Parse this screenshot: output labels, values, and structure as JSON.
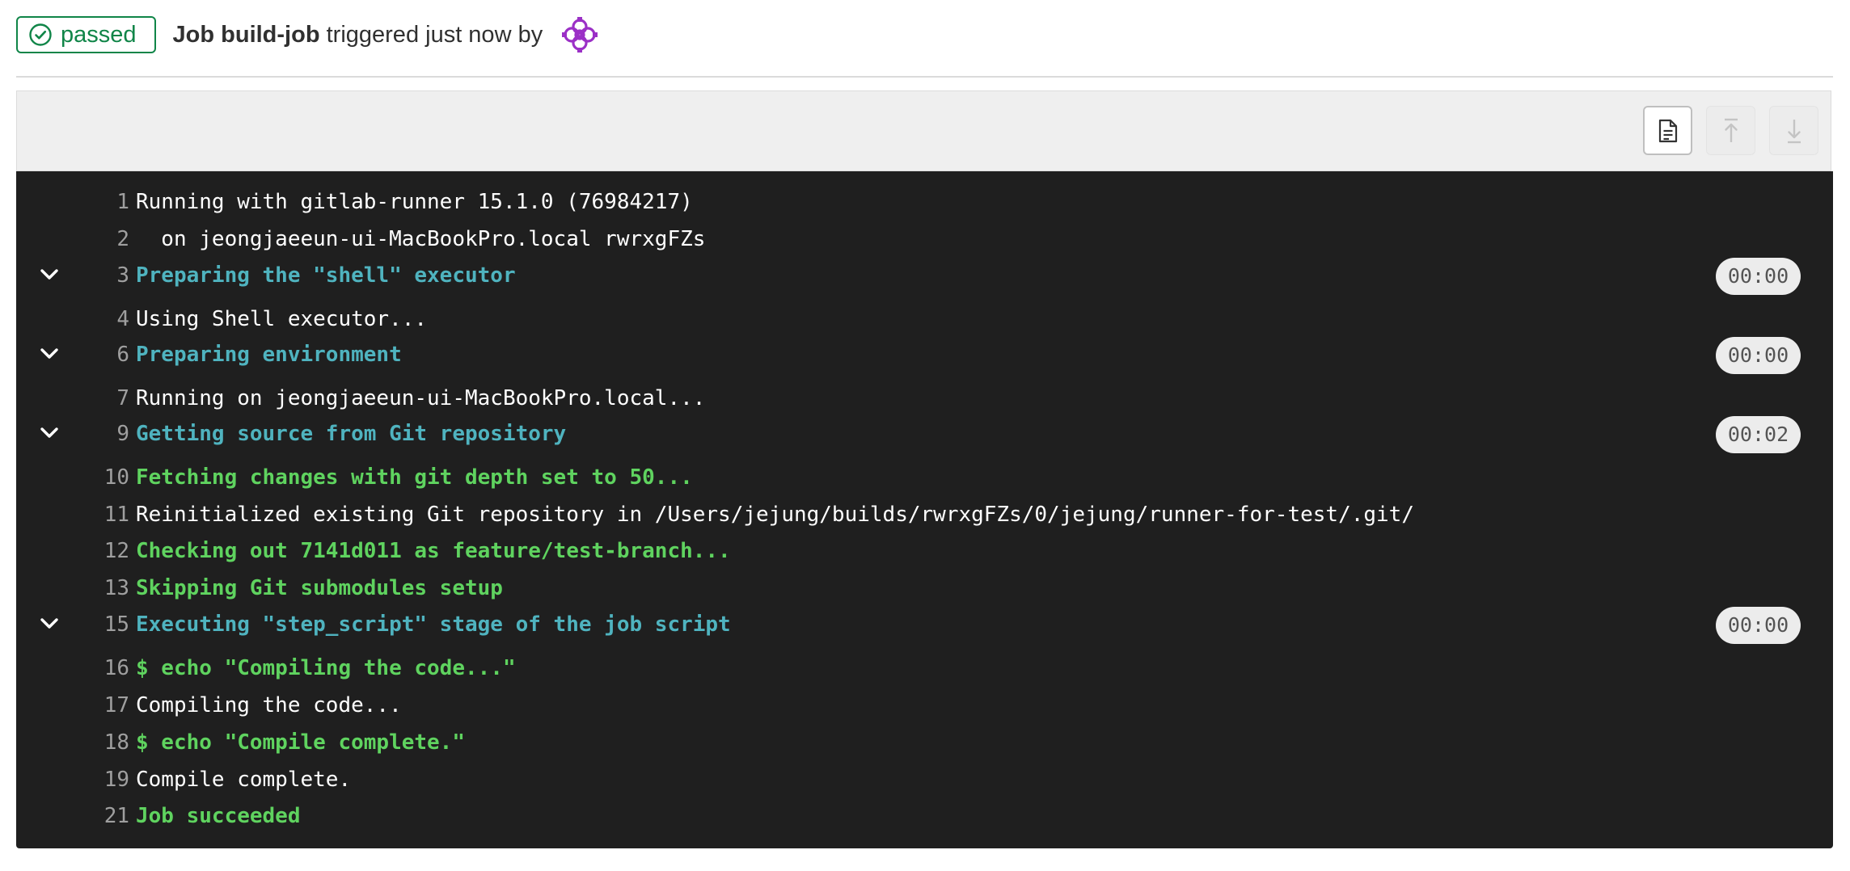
{
  "header": {
    "status_label": "passed",
    "job_prefix": "Job",
    "job_name": "build-job",
    "triggered_text": "triggered just now by"
  },
  "toolbar": {
    "raw_icon": "file-lines-icon",
    "scroll_top_icon": "scroll-to-top-icon",
    "scroll_bottom_icon": "scroll-to-bottom-icon"
  },
  "colors": {
    "success": "#108548",
    "log_bg": "#1f1f1f",
    "section_text": "#4fb3bf",
    "success_text": "#5fd35f"
  },
  "log": {
    "lines": [
      {
        "num": "1",
        "text": "Running with gitlab-runner 15.1.0 (76984217)",
        "style": "plain"
      },
      {
        "num": "2",
        "text": "  on jeongjaeeun-ui-MacBookPro.local rwrxgFZs",
        "style": "plain"
      },
      {
        "num": "3",
        "text": "Preparing the \"shell\" executor",
        "style": "section",
        "duration": "00:00"
      },
      {
        "num": "4",
        "text": "Using Shell executor...",
        "style": "plain"
      },
      {
        "num": "6",
        "text": "Preparing environment",
        "style": "section",
        "duration": "00:00"
      },
      {
        "num": "7",
        "text": "Running on jeongjaeeun-ui-MacBookPro.local...",
        "style": "plain"
      },
      {
        "num": "9",
        "text": "Getting source from Git repository",
        "style": "section",
        "duration": "00:02"
      },
      {
        "num": "10",
        "text": "Fetching changes with git depth set to 50...",
        "style": "success"
      },
      {
        "num": "11",
        "text": "Reinitialized existing Git repository in /Users/jejung/builds/rwrxgFZs/0/jejung/runner-for-test/.git/",
        "style": "plain"
      },
      {
        "num": "12",
        "text": "Checking out 7141d011 as feature/test-branch...",
        "style": "success"
      },
      {
        "num": "13",
        "text": "Skipping Git submodules setup",
        "style": "success"
      },
      {
        "num": "15",
        "text": "Executing \"step_script\" stage of the job script",
        "style": "section",
        "duration": "00:00"
      },
      {
        "num": "16",
        "text": "$ echo \"Compiling the code...\"",
        "style": "success"
      },
      {
        "num": "17",
        "text": "Compiling the code...",
        "style": "plain"
      },
      {
        "num": "18",
        "text": "$ echo \"Compile complete.\"",
        "style": "success"
      },
      {
        "num": "19",
        "text": "Compile complete.",
        "style": "plain"
      },
      {
        "num": "21",
        "text": "Job succeeded",
        "style": "success"
      }
    ]
  }
}
